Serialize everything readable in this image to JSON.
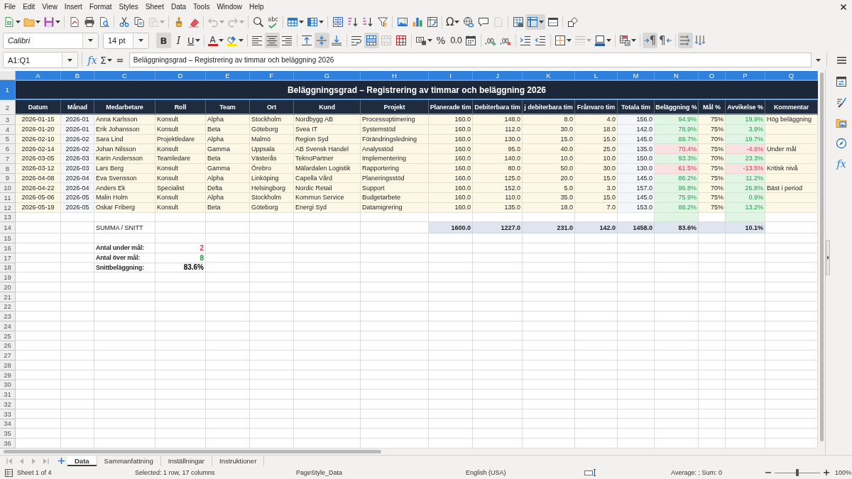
{
  "menu_bar": [
    "File",
    "Edit",
    "View",
    "Insert",
    "Format",
    "Styles",
    "Sheet",
    "Data",
    "Tools",
    "Window",
    "Help"
  ],
  "standard_toolbar": [
    [
      {
        "kind": "new",
        "menu": true,
        "pressed": false,
        "disabled": false
      },
      {
        "kind": "open",
        "menu": true,
        "pressed": false,
        "disabled": false
      },
      {
        "kind": "save",
        "menu": true,
        "pressed": false,
        "disabled": false
      }
    ],
    [
      {
        "kind": "export_pdf",
        "menu": false,
        "pressed": false,
        "disabled": false
      },
      {
        "kind": "print",
        "menu": false,
        "pressed": false,
        "disabled": false
      },
      {
        "kind": "print_preview",
        "menu": false,
        "pressed": false,
        "disabled": false
      }
    ],
    [
      {
        "kind": "cut",
        "menu": false,
        "pressed": false,
        "disabled": false
      },
      {
        "kind": "copy",
        "menu": false,
        "pressed": false,
        "disabled": false
      },
      {
        "kind": "paste",
        "menu": true,
        "pressed": false,
        "disabled": true
      }
    ],
    [
      {
        "kind": "clone_formatting",
        "menu": false,
        "pressed": false,
        "disabled": false
      },
      {
        "kind": "clear_formatting",
        "menu": false,
        "pressed": false,
        "disabled": false
      }
    ],
    [
      {
        "kind": "undo",
        "menu": true,
        "pressed": false,
        "disabled": true
      },
      {
        "kind": "redo",
        "menu": true,
        "pressed": false,
        "disabled": true
      }
    ],
    [
      {
        "kind": "find_replace",
        "menu": false,
        "pressed": false,
        "disabled": false
      },
      {
        "kind": "spelling",
        "label": "abc",
        "menu": false,
        "pressed": false,
        "disabled": false
      }
    ],
    [
      {
        "kind": "row",
        "menu": true,
        "pressed": false,
        "disabled": false
      },
      {
        "kind": "column",
        "menu": true,
        "pressed": false,
        "disabled": false
      }
    ],
    [
      {
        "kind": "sort",
        "menu": false,
        "pressed": false,
        "disabled": false
      },
      {
        "kind": "sort_ascending",
        "menu": false,
        "pressed": false,
        "disabled": false
      },
      {
        "kind": "sort_descending",
        "menu": false,
        "pressed": false,
        "disabled": false
      },
      {
        "kind": "autofilter",
        "menu": false,
        "pressed": false,
        "disabled": false
      }
    ],
    [
      {
        "kind": "image",
        "menu": false,
        "pressed": false,
        "disabled": false
      },
      {
        "kind": "chart",
        "menu": false,
        "pressed": false,
        "disabled": false
      },
      {
        "kind": "pivot_table",
        "menu": false,
        "pressed": false,
        "disabled": false
      }
    ],
    [
      {
        "kind": "special_character",
        "label": "Ω",
        "menu": true,
        "pressed": false,
        "disabled": false
      },
      {
        "kind": "hyperlink",
        "menu": false,
        "pressed": false,
        "disabled": false
      },
      {
        "kind": "comment",
        "menu": false,
        "pressed": false,
        "disabled": false
      },
      {
        "kind": "headers_footers",
        "menu": false,
        "pressed": false,
        "disabled": true
      }
    ],
    [
      {
        "kind": "print_area",
        "menu": false,
        "pressed": false,
        "disabled": false
      },
      {
        "kind": "freeze",
        "menu": true,
        "pressed": true,
        "disabled": false
      },
      {
        "kind": "split_window",
        "menu": false,
        "pressed": false,
        "disabled": false
      }
    ],
    [
      {
        "kind": "draw_functions",
        "menu": false,
        "pressed": false,
        "disabled": false
      }
    ]
  ],
  "formatting_toolbar": {
    "font_name": "Calibri",
    "font_size": "14 pt",
    "groups": [
      [
        {
          "kind": "bold",
          "label": "B",
          "menu": false,
          "pressed": true,
          "disabled": false
        },
        {
          "kind": "italic",
          "label": "I",
          "menu": false,
          "pressed": false,
          "disabled": false
        },
        {
          "kind": "underline",
          "label": "U",
          "menu": true,
          "pressed": false,
          "disabled": false
        }
      ],
      [
        {
          "kind": "font_color",
          "label": "A",
          "menu": true,
          "pressed": false,
          "disabled": false
        },
        {
          "kind": "highlight",
          "menu": true,
          "pressed": false,
          "disabled": false
        }
      ],
      [
        {
          "kind": "align_left",
          "menu": false,
          "pressed": false,
          "disabled": false
        },
        {
          "kind": "align_center",
          "menu": false,
          "pressed": true,
          "disabled": false
        },
        {
          "kind": "align_right",
          "menu": false,
          "pressed": false,
          "disabled": false
        }
      ],
      [
        {
          "kind": "align_top",
          "menu": false,
          "pressed": false,
          "disabled": false
        },
        {
          "kind": "align_middle",
          "menu": false,
          "pressed": true,
          "disabled": false
        },
        {
          "kind": "align_bottom",
          "menu": false,
          "pressed": false,
          "disabled": false
        }
      ],
      [
        {
          "kind": "wrap_text",
          "menu": false,
          "pressed": false,
          "disabled": false
        },
        {
          "kind": "merge_center",
          "menu": false,
          "pressed": true,
          "disabled": false
        },
        {
          "kind": "merge",
          "menu": false,
          "pressed": false,
          "disabled": true
        },
        {
          "kind": "unmerge",
          "menu": false,
          "pressed": false,
          "disabled": false
        }
      ],
      [
        {
          "kind": "currency",
          "menu": true,
          "pressed": false,
          "disabled": false
        },
        {
          "kind": "percent",
          "label": "%",
          "menu": false,
          "pressed": false,
          "disabled": false
        },
        {
          "kind": "number",
          "label": "0.0",
          "menu": false,
          "pressed": false,
          "disabled": false
        },
        {
          "kind": "date",
          "menu": false,
          "pressed": false,
          "disabled": false
        }
      ],
      [
        {
          "kind": "add_decimal",
          "menu": false,
          "pressed": false,
          "disabled": false
        },
        {
          "kind": "delete_decimal",
          "menu": false,
          "pressed": false,
          "disabled": false
        }
      ],
      [
        {
          "kind": "increase_indent",
          "menu": false,
          "pressed": false,
          "disabled": false
        },
        {
          "kind": "decrease_indent",
          "menu": false,
          "pressed": false,
          "disabled": false
        }
      ],
      [
        {
          "kind": "borders",
          "menu": true,
          "pressed": false,
          "disabled": false
        },
        {
          "kind": "border_style",
          "menu": true,
          "pressed": false,
          "disabled": true
        },
        {
          "kind": "border_color",
          "menu": true,
          "pressed": false,
          "disabled": false
        }
      ],
      [
        {
          "kind": "conditional",
          "menu": true,
          "pressed": false,
          "disabled": false
        }
      ],
      [
        {
          "kind": "left_to_right",
          "label": "¶",
          "menu": false,
          "pressed": true,
          "disabled": false
        },
        {
          "kind": "right_to_left",
          "label": "¶",
          "menu": false,
          "pressed": false,
          "disabled": false
        }
      ],
      [
        {
          "kind": "text_horizontal",
          "menu": false,
          "pressed": true,
          "disabled": false
        },
        {
          "kind": "text_vertical",
          "menu": false,
          "pressed": false,
          "disabled": false
        }
      ]
    ]
  },
  "formula_bar": {
    "name_box": "A1:Q1",
    "buttons": [
      {
        "kind": "function_wizard",
        "label": "fx",
        "menu": false
      },
      {
        "kind": "sum",
        "label": "Σ",
        "menu": true
      },
      {
        "kind": "formula",
        "label": "=",
        "menu": false
      }
    ],
    "content": "Beläggningsgrad – Registrering av timmar och beläggning 2026"
  },
  "sidebar": {
    "buttons": [
      {
        "kind": "properties"
      },
      {
        "kind": "styles"
      },
      {
        "kind": "gallery"
      },
      {
        "kind": "navigator"
      },
      {
        "kind": "functions",
        "label": "fx"
      }
    ]
  },
  "grid": {
    "columns": [
      {
        "label": "A",
        "selected": true
      },
      {
        "label": "B",
        "selected": true
      },
      {
        "label": "C",
        "selected": true
      },
      {
        "label": "D",
        "selected": true
      },
      {
        "label": "E",
        "selected": true
      },
      {
        "label": "F",
        "selected": true
      },
      {
        "label": "G",
        "selected": true
      },
      {
        "label": "H",
        "selected": true
      },
      {
        "label": "I",
        "selected": true
      },
      {
        "label": "J",
        "selected": true
      },
      {
        "label": "K",
        "selected": true
      },
      {
        "label": "L",
        "selected": true
      },
      {
        "label": "M",
        "selected": true
      },
      {
        "label": "N",
        "selected": true
      },
      {
        "label": "O",
        "selected": true
      },
      {
        "label": "P",
        "selected": true
      },
      {
        "label": "Q",
        "selected": true
      }
    ],
    "rows": [
      {
        "header": "1",
        "selected": true,
        "kind": "title",
        "title": "Beläggningsgrad – Registrering av timmar och beläggning 2026"
      },
      {
        "header": "2",
        "selected": false,
        "kind": "header",
        "cells": [
          "Datum",
          "Månad",
          "Medarbetare",
          "Roll",
          "Team",
          "Ort",
          "Kund",
          "Projekt",
          "Planerade tim",
          "Debiterbara tim",
          "j debiterbara tim",
          "Frånvaro tim",
          "Totala tim",
          "Beläggning %",
          "Mål %",
          "Avvikelse %",
          "Kommentar"
        ]
      },
      {
        "header": "3",
        "selected": false,
        "kind": "entry",
        "under_target": false,
        "date": "2026-01-15",
        "month": "2026-01",
        "employee": "Anna Karlsson",
        "role": "Konsult",
        "team": "Alpha",
        "city": "Stockholm",
        "client": "Nordbygg AB",
        "project": "Processoptimering",
        "planned": "160.0",
        "billable": "148.0",
        "non_billable": "8.0",
        "absence": "4.0",
        "total": "156.0",
        "utilization": "94.9%",
        "target": "75%",
        "deviation": "19.9%",
        "comment": "Hög beläggning"
      },
      {
        "header": "4",
        "selected": false,
        "kind": "entry",
        "under_target": false,
        "date": "2026-01-20",
        "month": "2026-01",
        "employee": "Erik Johansson",
        "role": "Konsult",
        "team": "Beta",
        "city": "Göteborg",
        "client": "Svea IT",
        "project": "Systemstöd",
        "planned": "160.0",
        "billable": "112.0",
        "non_billable": "30.0",
        "absence": "18.0",
        "total": "142.0",
        "utilization": "78.9%",
        "target": "75%",
        "deviation": "3.9%"
      },
      {
        "header": "5",
        "selected": false,
        "kind": "entry",
        "under_target": false,
        "date": "2026-02-10",
        "month": "2026-02",
        "employee": "Sara Lind",
        "role": "Projektledare",
        "team": "Alpha",
        "city": "Malmö",
        "client": "Region Syd",
        "project": "Förändringsledning",
        "planned": "160.0",
        "billable": "130.0",
        "non_billable": "15.0",
        "absence": "15.0",
        "total": "145.0",
        "utilization": "89.7%",
        "target": "70%",
        "deviation": "19.7%"
      },
      {
        "header": "6",
        "selected": false,
        "kind": "entry",
        "under_target": true,
        "date": "2026-02-14",
        "month": "2026-02",
        "employee": "Johan Nilsson",
        "role": "Konsult",
        "team": "Gamma",
        "city": "Uppsala",
        "client": "AB Svensk Handel",
        "project": "Analysstöd",
        "planned": "160.0",
        "billable": "95.0",
        "non_billable": "40.0",
        "absence": "25.0",
        "total": "135.0",
        "utilization": "70.4%",
        "target": "75%",
        "deviation": "-4.6%",
        "comment": "Under mål"
      },
      {
        "header": "7",
        "selected": false,
        "kind": "entry",
        "under_target": false,
        "date": "2026-03-05",
        "month": "2026-03",
        "employee": "Karin Andersson",
        "role": "Teamledare",
        "team": "Beta",
        "city": "Västerås",
        "client": "TeknoPartner",
        "project": "Implementering",
        "planned": "160.0",
        "billable": "140.0",
        "non_billable": "10.0",
        "absence": "10.0",
        "total": "150.0",
        "utilization": "93.3%",
        "target": "70%",
        "deviation": "23.3%"
      },
      {
        "header": "8",
        "selected": false,
        "kind": "entry",
        "under_target": true,
        "date": "2026-03-12",
        "month": "2026-03",
        "employee": "Lars Berg",
        "role": "Konsult",
        "team": "Gamma",
        "city": "Örebro",
        "client": "Mälardalen Logistik",
        "project": "Rapportering",
        "planned": "160.0",
        "billable": "80.0",
        "non_billable": "50.0",
        "absence": "30.0",
        "total": "130.0",
        "utilization": "61.5%",
        "target": "75%",
        "deviation": "-13.5%",
        "comment": "Kritisk nivå"
      },
      {
        "header": "9",
        "selected": false,
        "kind": "entry",
        "under_target": false,
        "date": "2026-04-08",
        "month": "2026-04",
        "employee": "Eva Svensson",
        "role": "Konsult",
        "team": "Alpha",
        "city": "Linköping",
        "client": "Capella Vård",
        "project": "Planeringsstöd",
        "planned": "160.0",
        "billable": "125.0",
        "non_billable": "20.0",
        "absence": "15.0",
        "total": "145.0",
        "utilization": "86.2%",
        "target": "75%",
        "deviation": "11.2%"
      },
      {
        "header": "10",
        "selected": false,
        "kind": "entry",
        "under_target": false,
        "date": "2026-04-22",
        "month": "2026-04",
        "employee": "Anders Ek",
        "role": "Specialist",
        "team": "Delta",
        "city": "Helsingborg",
        "client": "Nordic Retail",
        "project": "Support",
        "planned": "160.0",
        "billable": "152.0",
        "non_billable": "5.0",
        "absence": "3.0",
        "total": "157.0",
        "utilization": "96.8%",
        "target": "70%",
        "deviation": "26.8%",
        "comment": "Bäst i period"
      },
      {
        "header": "11",
        "selected": false,
        "kind": "entry",
        "under_target": false,
        "date": "2026-05-06",
        "month": "2026-05",
        "employee": "Malin Holm",
        "role": "Konsult",
        "team": "Alpha",
        "city": "Stockholm",
        "client": "Kommun Service",
        "project": "Budgetarbete",
        "planned": "160.0",
        "billable": "110.0",
        "non_billable": "35.0",
        "absence": "15.0",
        "total": "145.0",
        "utilization": "75.9%",
        "target": "75%",
        "deviation": "0.9%"
      },
      {
        "header": "12",
        "selected": false,
        "kind": "entry",
        "under_target": false,
        "date": "2026-05-19",
        "month": "2026-05",
        "employee": "Oskar Friberg",
        "role": "Konsult",
        "team": "Beta",
        "city": "Göteborg",
        "client": "Energi Syd",
        "project": "Datamigrering",
        "planned": "160.0",
        "billable": "135.0",
        "non_billable": "18.0",
        "absence": "7.0",
        "total": "153.0",
        "utilization": "88.2%",
        "target": "75%",
        "deviation": "13.2%"
      },
      {
        "header": "13",
        "selected": false,
        "kind": "blank",
        "under_target": false
      },
      {
        "header": "14",
        "selected": false,
        "kind": "total",
        "label": "SUMMA / SNITT",
        "planned": "1600.0",
        "billable": "1227.0",
        "non_billable": "231.0",
        "absence": "142.0",
        "total": "1458.0",
        "utilization": "83.6%",
        "deviation": "10.1%"
      },
      {
        "header": "15",
        "selected": false,
        "kind": "empty"
      },
      {
        "header": "16",
        "selected": false,
        "kind": "stat",
        "label": "Antal under mål:",
        "value": "2",
        "color": "#e0383e"
      },
      {
        "header": "17",
        "selected": false,
        "kind": "stat",
        "label": "Antal över mål:",
        "value": "8",
        "color": "#1f9d45"
      },
      {
        "header": "18",
        "selected": false,
        "kind": "stat",
        "label": "Snittbeläggning:",
        "value": "83.6%",
        "color": "#000000"
      },
      {
        "header": "19",
        "selected": false,
        "kind": "empty"
      },
      {
        "header": "20",
        "selected": false,
        "kind": "empty"
      },
      {
        "header": "21",
        "selected": false,
        "kind": "empty"
      },
      {
        "header": "22",
        "selected": false,
        "kind": "empty"
      },
      {
        "header": "23",
        "selected": false,
        "kind": "empty"
      },
      {
        "header": "24",
        "selected": false,
        "kind": "empty"
      },
      {
        "header": "25",
        "selected": false,
        "kind": "empty"
      },
      {
        "header": "26",
        "selected": false,
        "kind": "empty"
      },
      {
        "header": "27",
        "selected": false,
        "kind": "empty"
      },
      {
        "header": "28",
        "selected": false,
        "kind": "empty"
      },
      {
        "header": "29",
        "selected": false,
        "kind": "empty"
      },
      {
        "header": "30",
        "selected": false,
        "kind": "empty"
      },
      {
        "header": "31",
        "selected": false,
        "kind": "empty"
      },
      {
        "header": "32",
        "selected": false,
        "kind": "empty"
      },
      {
        "header": "33",
        "selected": false,
        "kind": "empty"
      },
      {
        "header": "34",
        "selected": false,
        "kind": "empty"
      },
      {
        "header": "35",
        "selected": false,
        "kind": "empty"
      },
      {
        "header": "36",
        "selected": false,
        "kind": "empty"
      }
    ]
  },
  "sheet_bar": {
    "navigation_disabled": true,
    "tabs": [
      {
        "label": "Data",
        "selected": true
      },
      {
        "label": "Sammanfattning",
        "selected": false
      },
      {
        "label": "Inställningar",
        "selected": false
      },
      {
        "label": "Instruktioner",
        "selected": false
      }
    ]
  },
  "status_bar": {
    "sheet": "Sheet 1 of 4",
    "selection": "Selected: 1 row, 17 columns",
    "page_style": "PageStyle_Data",
    "language": "English (USA)",
    "summary": "Average: ; Sum: 0",
    "zoom": {
      "level": 0.5,
      "label": "100%"
    }
  }
}
